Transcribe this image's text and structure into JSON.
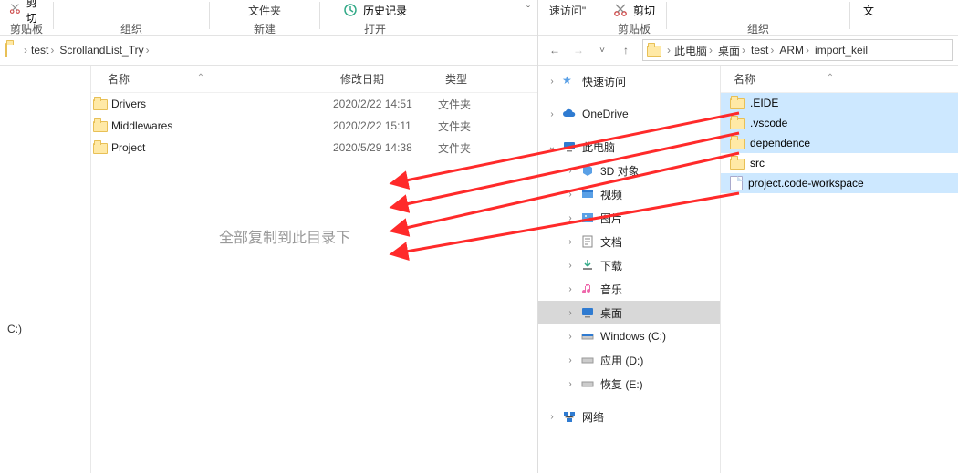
{
  "left": {
    "ribbon": {
      "cut": "剪切",
      "clipboard": "剪贴板",
      "organize": "组织",
      "folder": "文件夹",
      "new": "新建",
      "history": "历史记录",
      "open": "打开"
    },
    "breadcrumbs": [
      "test",
      "ScrollandList_Try"
    ],
    "sidebar": {
      "drive": "C:)"
    },
    "columns": {
      "name": "名称",
      "date": "修改日期",
      "type": "类型"
    },
    "rows": [
      {
        "name": "Drivers",
        "date": "2020/2/22 14:51",
        "type": "文件夹"
      },
      {
        "name": "Middlewares",
        "date": "2020/2/22 15:11",
        "type": "文件夹"
      },
      {
        "name": "Project",
        "date": "2020/5/29 14:38",
        "type": "文件夹"
      }
    ],
    "overlay_text": "全部复制到此目录下"
  },
  "right": {
    "ribbon": {
      "quick": "速访问\"",
      "cut": "剪切",
      "clipboard": "剪贴板",
      "organize": "组织",
      "extra": "文"
    },
    "breadcrumbs": [
      "此电脑",
      "桌面",
      "test",
      "ARM",
      "import_keil"
    ],
    "tree": {
      "quick_access": "快速访问",
      "onedrive": "OneDrive",
      "this_pc": "此电脑",
      "items": [
        "3D 对象",
        "视频",
        "图片",
        "文档",
        "下载",
        "音乐",
        "桌面",
        "Windows (C:)",
        "应用 (D:)",
        "恢复 (E:)"
      ],
      "network": "网络"
    },
    "columns": {
      "name": "名称"
    },
    "rows": [
      {
        "name": ".EIDE",
        "type": "folder",
        "sel": true
      },
      {
        "name": ".vscode",
        "type": "folder",
        "sel": true
      },
      {
        "name": "dependence",
        "type": "folder",
        "sel": true
      },
      {
        "name": "src",
        "type": "folder",
        "sel": false
      },
      {
        "name": "project.code-workspace",
        "type": "file",
        "sel": true
      }
    ]
  }
}
